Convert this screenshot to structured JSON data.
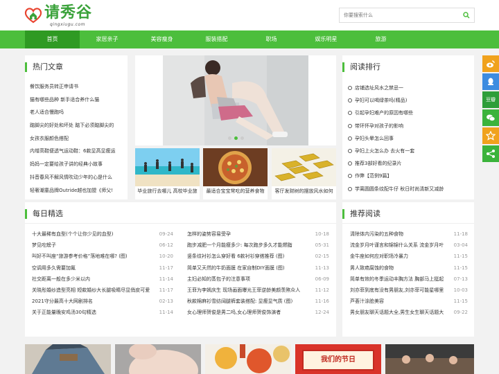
{
  "site": {
    "logo_text": "请秀谷",
    "logo_sub": "qingxiugu.com",
    "search_placeholder": "你要搜索什么"
  },
  "nav": [
    "首页",
    "家居亲子",
    "美容瘦身",
    "服装搭配",
    "职场",
    "娱乐明星",
    "旅游"
  ],
  "hot": {
    "title": "热门文章",
    "items": [
      "餐饮服务员转正申请书",
      "猫有哪些品种 新手适合养什么猫",
      "老人适合慢跑吗",
      "踮脚尖的好处和坏处 踮下必须踮脚尖的",
      "女孩衣服颜色搭配",
      "内增高鞋便透气运动鞋：6款显高显瘦运",
      "妈妈一定要给孩子讲的经典小故事",
      "抖音春风不解风情吹动少年的心是什么",
      "轻奢潮童品牌Outride越也加盟《师父!"
    ]
  },
  "slider": {
    "active_dot": 2
  },
  "thumbs": [
    "毕业旅行去哪儿 高校毕业旅",
    "最适合宝宝常吃的营养食物",
    "客厅发财树的摆放风水如何"
  ],
  "rank": {
    "title": "阅读排行",
    "items": [
      "店铺选址风水之禁忌一",
      "孕妇可以喝绿茶吗(精品)",
      "引起孕妇难产的原因有哪些",
      "带环怀孕对孩子的影响",
      "孕妇头晕怎么回事",
      "孕妇上火怎么办 去火有一套",
      "推荐3部好看的纪录片",
      "作弊【范例9篇】",
      "学离圆圆条纹配牛仔 秋日时尚清新又减龄"
    ]
  },
  "share": [
    {
      "name": "weibo",
      "label": "微博",
      "color": "#f0a21d"
    },
    {
      "name": "qq",
      "label": "QQ",
      "color": "#3d8ce0"
    },
    {
      "name": "douban",
      "label": "豆瓣",
      "color": "#2e9e3a"
    },
    {
      "name": "wechat",
      "label": "微信",
      "color": "#3bb33b"
    },
    {
      "name": "favorite",
      "label": "收藏",
      "color": "#f0a21d"
    },
    {
      "name": "share",
      "label": "分享",
      "color": "#3bb33b"
    }
  ],
  "daily": {
    "title": "每日精选",
    "left": [
      {
        "t": "十大最稀有血型(个个让你少见的血型)",
        "d": "09-24"
      },
      {
        "t": "梦见吃螃子",
        "d": "06-12"
      },
      {
        "t": "叫好不叫座“旅游参考价格”落地难在哪? (图)",
        "d": "10-20"
      },
      {
        "t": "空调用多久需要加氟",
        "d": "11-17"
      },
      {
        "t": "社交距离一般在多少米以内",
        "d": "11-14"
      },
      {
        "t": "关晓彤婚纱造型亮相 短款婚纱大长腿吸睛尽显俏皮可爱",
        "d": "11-17"
      },
      {
        "t": "2021守分最高十大网剧排名",
        "d": "02-13"
      },
      {
        "t": "关于正能量晚安鸡汤30句精选",
        "d": "11-14"
      }
    ],
    "right": [
      {
        "t": "怎样的姿势容易受孕",
        "d": "10-18"
      },
      {
        "t": "跑步减肥一个月能瘦多少: 每次跑步多久才能燃脂",
        "d": "05-31"
      },
      {
        "t": "竖条纹衬衫怎么穿好看 6款衬衫穿搭推荐 (图)",
        "d": "02-15"
      },
      {
        "t": "简单又天然的牛奶面膜 在家自制DIY面膜 (图)",
        "d": "11-13"
      },
      {
        "t": "主妇必知的蒸包子的注意事项",
        "d": "06-09"
      },
      {
        "t": "王菲为李嫣庆生 现场画面曝光王菲逆龄美颜羡煞众人",
        "d": "11-12"
      },
      {
        "t": "秋款棉麻衫雪纺阔腿裤套装搭配: 显瘦显气质 (图)",
        "d": "11-16"
      },
      {
        "t": "女心理师贺俊是男二吗,女心理师贺俊饰演者",
        "d": "12-24"
      }
    ]
  },
  "recommend": {
    "title": "推荐阅读",
    "items": [
      {
        "t": "清除体内污染的五种食物",
        "d": "11-18"
      },
      {
        "t": "流金岁月叶谨言和锦锦什么关系 流金岁月叶",
        "d": "03-04"
      },
      {
        "t": "金牛座如何应对职场冷暴力",
        "d": "11-15"
      },
      {
        "t": "男人致癌腐蚀的食物",
        "d": "11-15"
      },
      {
        "t": "简单有效的冬季运动丰胸方法 胸部马上挺起",
        "d": "07-13"
      },
      {
        "t": "刘亦菲到底有没有男朋友,刘亦菲可能星哪里",
        "d": "10-03"
      },
      {
        "t": "芦荟汁涂脸美容",
        "d": "11-15"
      },
      {
        "t": "男女朋友聊天话题大全,男生女生聊天话题大",
        "d": "09-22"
      }
    ]
  },
  "bottom_banner_text": "我们的节日"
}
